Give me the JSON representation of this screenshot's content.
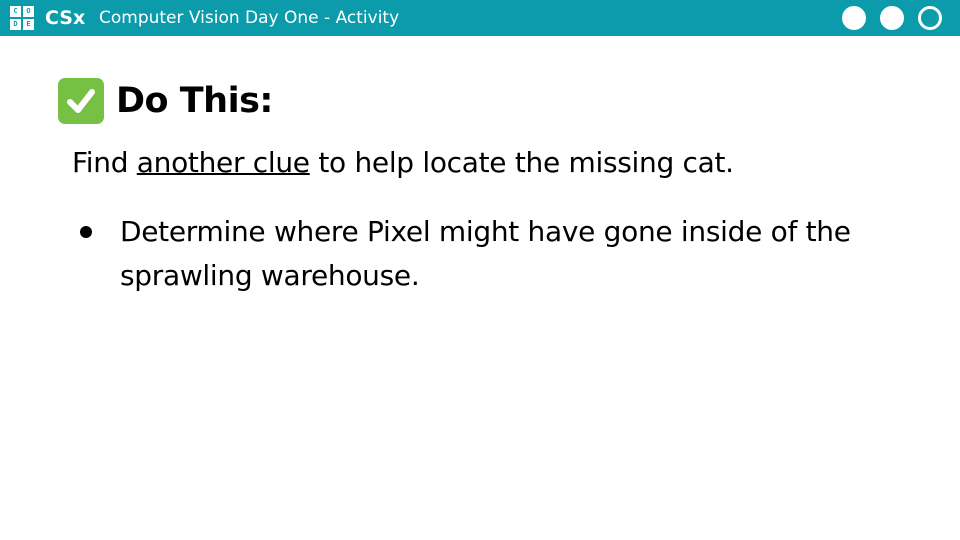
{
  "header": {
    "logo_letters": [
      "C",
      "O",
      "D",
      "E"
    ],
    "brand": "CSx",
    "lesson_title": "Computer Vision Day One - Activity",
    "progress": {
      "filled": 2,
      "total": 3
    }
  },
  "colors": {
    "header_bg": "#0c9bab",
    "check_green": "#76c043"
  },
  "slide": {
    "heading_icon": "check-mark-button-icon",
    "heading": "Do This:",
    "intro_before": "Find ",
    "intro_link": "another clue",
    "intro_after": " to help locate the missing cat.",
    "bullets": [
      "Determine where Pixel might have gone inside of the sprawling warehouse."
    ]
  }
}
